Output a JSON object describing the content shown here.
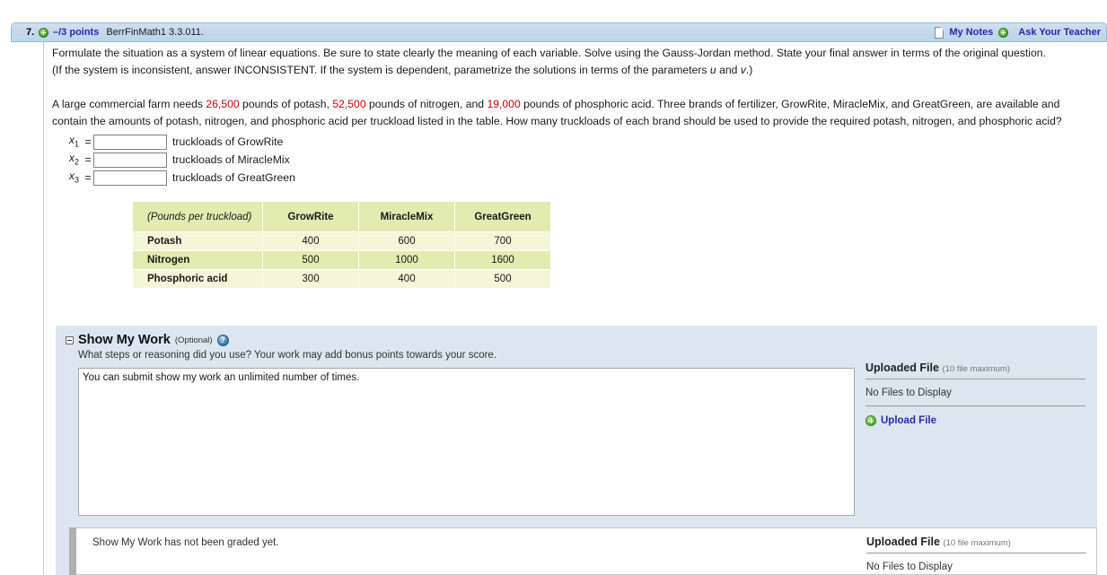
{
  "header": {
    "question_number": "7.",
    "points": "–/3 points",
    "question_code": "BerrFinMath1 3.3.011.",
    "my_notes_label": "My Notes",
    "ask_teacher_label": "Ask Your Teacher",
    "plus_icon": "plus-circle-icon",
    "notes_icon": "note-page-icon"
  },
  "question": {
    "instructions_line1": "Formulate the situation as a system of linear equations. Be sure to state clearly the meaning of each variable. Solve using the Gauss-Jordan method. State your final answer in terms of the original question.",
    "instructions_line2_a": "(If the system is inconsistent, answer INCONSISTENT. If the system is dependent, parametrize the solutions in terms of the parameters ",
    "param_u": "u",
    "instructions_line2_b": " and ",
    "param_v": "v",
    "instructions_line2_c": ".)",
    "body_a": "A large commercial farm needs ",
    "potash_required": "26,500",
    "body_b": " pounds of potash, ",
    "nitrogen_required": "52,500",
    "body_c": " pounds of nitrogen, and ",
    "phosphoric_required": "19,000",
    "body_d": " pounds of phosphoric acid. Three brands of fertilizer, GrowRite, MiracleMix, and GreatGreen, are available and contain the amounts of potash, nitrogen, and phosphoric acid per truckload listed in the table. How many truckloads of each brand should be used to provide the required potash, nitrogen, and phosphoric acid?"
  },
  "answers": [
    {
      "var": "x",
      "sub": "1",
      "eq": "=",
      "value": "",
      "label": "truckloads of GrowRite"
    },
    {
      "var": "x",
      "sub": "2",
      "eq": "=",
      "value": "",
      "label": "truckloads of MiracleMix"
    },
    {
      "var": "x",
      "sub": "3",
      "eq": "=",
      "value": "",
      "label": "truckloads of GreatGreen"
    }
  ],
  "table": {
    "corner_label": "(Pounds per truckload)",
    "columns": [
      "GrowRite",
      "MiracleMix",
      "GreatGreen"
    ],
    "rows": [
      {
        "label": "Potash",
        "values": [
          "400",
          "600",
          "700"
        ]
      },
      {
        "label": "Nitrogen",
        "values": [
          "500",
          "1000",
          "1600"
        ]
      },
      {
        "label": "Phosphoric acid",
        "values": [
          "300",
          "400",
          "500"
        ]
      }
    ],
    "header_bg": "#e2ebb0",
    "body_bg_odd": "#f3f6d8",
    "body_bg_even": "#e2ebb0"
  },
  "show_my_work": {
    "title": "Show My Work",
    "optional": "(Optional)",
    "help_icon": "question-mark-circle-icon",
    "collapse_icon": "collapse-minus-icon",
    "subtitle": "What steps or reasoning did you use? Your work may add bonus points towards your score.",
    "textarea_value": "You can submit show my work an unlimited number of times.",
    "textarea_placeholder": ""
  },
  "uploaded_file_top": {
    "title": "Uploaded File",
    "max_note": "(10 file maximum)",
    "no_files": "No Files to Display",
    "upload_label": "Upload File",
    "upload_icon": "plus-circle-icon"
  },
  "graded": {
    "status_text": "Show My Work has not been graded yet."
  },
  "uploaded_file_bottom": {
    "title": "Uploaded File",
    "max_note": "(10 file maximum)",
    "no_files": "No Files to Display"
  },
  "colors": {
    "header_bg": "#c3d8ec",
    "link": "#2727b0",
    "highlight_red": "#cc0000",
    "panel_bg": "#dce6f0"
  }
}
